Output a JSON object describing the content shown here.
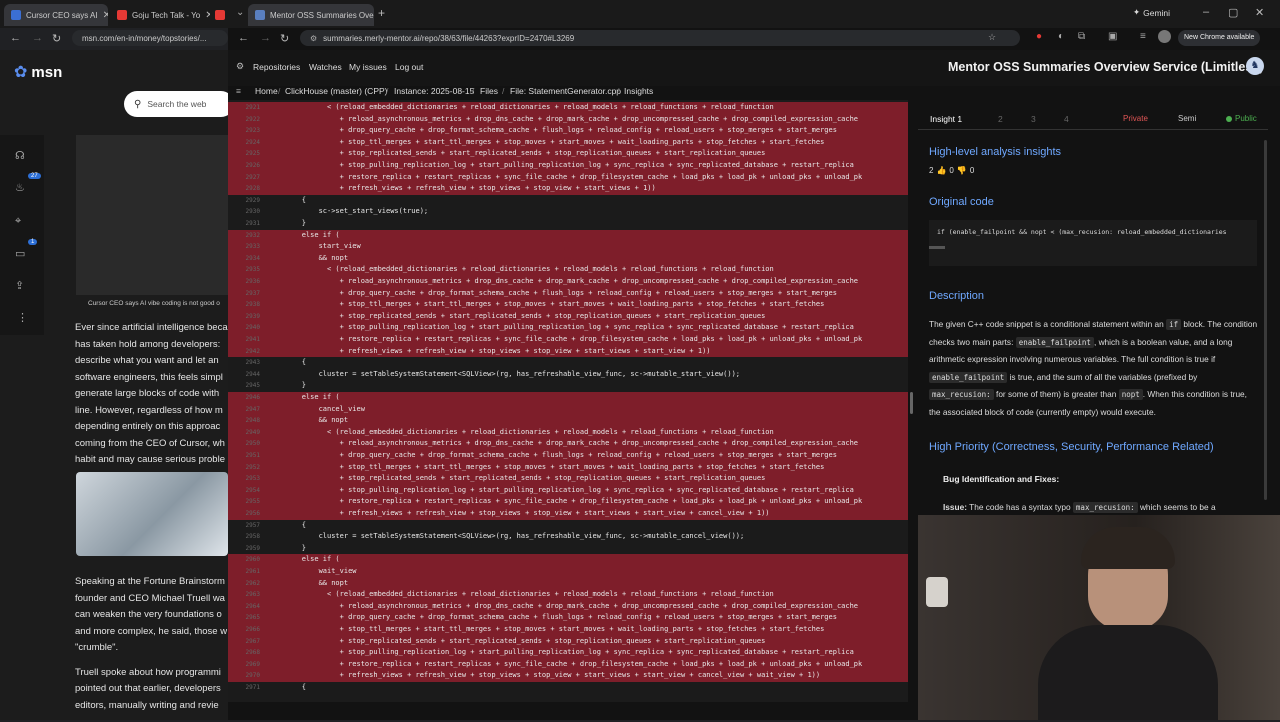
{
  "left_window": {
    "tabs": [
      {
        "title": "Cursor CEO says AI",
        "color": "#3b6fd4"
      },
      {
        "title": "Goju Tech Talk - Yo",
        "color": "#e53935"
      }
    ],
    "url": "msn.com/en-in/money/topstories/...",
    "brand": "msn",
    "search_placeholder": "Search the web",
    "badges": [
      "27",
      "1"
    ],
    "video_caption": "Cursor CEO says AI vibe coding is not good o",
    "paragraphs": [
      "Ever since artificial intelligence beca",
      "has taken hold among developers:",
      "describe what you want and let an",
      "software engineers, this feels simpl",
      "generate large blocks of code with",
      "line. However, regardless of how m",
      "depending entirely on this approac",
      "coming from the CEO of Cursor, wh",
      "habit and may cause serious proble"
    ],
    "paragraphs2": [
      "Speaking at the Fortune Brainstorm",
      "founder and CEO Michael Truell wa",
      "can weaken the very foundations o",
      "and more complex, he said, those w",
      "\"crumble\"."
    ],
    "paragraphs3": [
      "Truell spoke about how programmi",
      "pointed out that earlier, developers",
      "editors, manually writing and revie"
    ]
  },
  "right_window": {
    "tab_title": "Mentor OSS Summaries Overvi",
    "url": "summaries.merly-mentor.ai/repo/38/63/file/44263?exprID=2470#L3269",
    "gemini": "Gemini",
    "new_chrome": "New Chrome available",
    "nav": [
      "Repositories",
      "Watches",
      "My issues",
      "Log out"
    ],
    "site_title": "Mentor OSS Summaries Overview Service (Limitless)",
    "breadcrumb": [
      "Home",
      "ClickHouse (master) (CPP)",
      "Instance: 2025-08-15",
      "Files",
      "File: StatementGenerator.cpp",
      "Insights"
    ]
  },
  "code": {
    "lines": [
      {
        "n": "2921",
        "hl": true,
        "t": "              < (reload_embedded_dictionaries + reload_dictionaries + reload_models + reload_functions + reload_function"
      },
      {
        "n": "2922",
        "hl": true,
        "t": "                 + reload_asynchronous_metrics + drop_dns_cache + drop_mark_cache + drop_uncompressed_cache + drop_compiled_expression_cache"
      },
      {
        "n": "2923",
        "hl": true,
        "t": "                 + drop_query_cache + drop_format_schema_cache + flush_logs + reload_config + reload_users + stop_merges + start_merges"
      },
      {
        "n": "2924",
        "hl": true,
        "t": "                 + stop_ttl_merges + start_ttl_merges + stop_moves + start_moves + wait_loading_parts + stop_fetches + start_fetches"
      },
      {
        "n": "2925",
        "hl": true,
        "t": "                 + stop_replicated_sends + start_replicated_sends + stop_replication_queues + start_replication_queues"
      },
      {
        "n": "2926",
        "hl": true,
        "t": "                 + stop_pulling_replication_log + start_pulling_replication_log + sync_replica + sync_replicated_database + restart_replica"
      },
      {
        "n": "2927",
        "hl": true,
        "t": "                 + restore_replica + restart_replicas + sync_file_cache + drop_filesystem_cache + load_pks + load_pk + unload_pks + unload_pk"
      },
      {
        "n": "2928",
        "hl": true,
        "t": "                 + refresh_views + refresh_view + stop_views + stop_view + start_views + 1))"
      },
      {
        "n": "2929",
        "hl": false,
        "t": "        {"
      },
      {
        "n": "2930",
        "hl": false,
        "t": "            sc->set_start_views(true);"
      },
      {
        "n": "2931",
        "hl": false,
        "t": "        }"
      },
      {
        "n": "2932",
        "hl": true,
        "t": "        else if ("
      },
      {
        "n": "2933",
        "hl": true,
        "t": "            start_view"
      },
      {
        "n": "2934",
        "hl": true,
        "t": "            && nopt"
      },
      {
        "n": "2935",
        "hl": true,
        "t": "              < (reload_embedded_dictionaries + reload_dictionaries + reload_models + reload_functions + reload_function"
      },
      {
        "n": "2936",
        "hl": true,
        "t": "                 + reload_asynchronous_metrics + drop_dns_cache + drop_mark_cache + drop_uncompressed_cache + drop_compiled_expression_cache"
      },
      {
        "n": "2937",
        "hl": true,
        "t": "                 + drop_query_cache + drop_format_schema_cache + flush_logs + reload_config + reload_users + stop_merges + start_merges"
      },
      {
        "n": "2938",
        "hl": true,
        "t": "                 + stop_ttl_merges + start_ttl_merges + stop_moves + start_moves + wait_loading_parts + stop_fetches + start_fetches"
      },
      {
        "n": "2939",
        "hl": true,
        "t": "                 + stop_replicated_sends + start_replicated_sends + stop_replication_queues + start_replication_queues"
      },
      {
        "n": "2940",
        "hl": true,
        "t": "                 + stop_pulling_replication_log + start_pulling_replication_log + sync_replica + sync_replicated_database + restart_replica"
      },
      {
        "n": "2941",
        "hl": true,
        "t": "                 + restore_replica + restart_replicas + sync_file_cache + drop_filesystem_cache + load_pks + load_pk + unload_pks + unload_pk"
      },
      {
        "n": "2942",
        "hl": true,
        "t": "                 + refresh_views + refresh_view + stop_views + stop_view + start_views + start_view + 1))"
      },
      {
        "n": "2943",
        "hl": false,
        "t": "        {"
      },
      {
        "n": "2944",
        "hl": false,
        "t": "            cluster = setTableSystemStatement<SQLView>(rg, has_refreshable_view_func, sc->mutable_start_view());"
      },
      {
        "n": "2945",
        "hl": false,
        "t": "        }"
      },
      {
        "n": "2946",
        "hl": true,
        "t": "        else if ("
      },
      {
        "n": "2947",
        "hl": true,
        "t": "            cancel_view"
      },
      {
        "n": "2948",
        "hl": true,
        "t": "            && nopt"
      },
      {
        "n": "2949",
        "hl": true,
        "t": "              < (reload_embedded_dictionaries + reload_dictionaries + reload_models + reload_functions + reload_function"
      },
      {
        "n": "2950",
        "hl": true,
        "t": "                 + reload_asynchronous_metrics + drop_dns_cache + drop_mark_cache + drop_uncompressed_cache + drop_compiled_expression_cache"
      },
      {
        "n": "2951",
        "hl": true,
        "t": "                 + drop_query_cache + drop_format_schema_cache + flush_logs + reload_config + reload_users + stop_merges + start_merges"
      },
      {
        "n": "2952",
        "hl": true,
        "t": "                 + stop_ttl_merges + start_ttl_merges + stop_moves + start_moves + wait_loading_parts + stop_fetches + start_fetches"
      },
      {
        "n": "2953",
        "hl": true,
        "t": "                 + stop_replicated_sends + start_replicated_sends + stop_replication_queues + start_replication_queues"
      },
      {
        "n": "2954",
        "hl": true,
        "t": "                 + stop_pulling_replication_log + start_pulling_replication_log + sync_replica + sync_replicated_database + restart_replica"
      },
      {
        "n": "2955",
        "hl": true,
        "t": "                 + restore_replica + restart_replicas + sync_file_cache + drop_filesystem_cache + load_pks + load_pk + unload_pks + unload_pk"
      },
      {
        "n": "2956",
        "hl": true,
        "t": "                 + refresh_views + refresh_view + stop_views + stop_view + start_views + start_view + cancel_view + 1))"
      },
      {
        "n": "2957",
        "hl": false,
        "t": "        {"
      },
      {
        "n": "2958",
        "hl": false,
        "t": "            cluster = setTableSystemStatement<SQLView>(rg, has_refreshable_view_func, sc->mutable_cancel_view());"
      },
      {
        "n": "2959",
        "hl": false,
        "t": "        }"
      },
      {
        "n": "2960",
        "hl": true,
        "t": "        else if ("
      },
      {
        "n": "2961",
        "hl": true,
        "t": "            wait_view"
      },
      {
        "n": "2962",
        "hl": true,
        "t": "            && nopt"
      },
      {
        "n": "2963",
        "hl": true,
        "t": "              < (reload_embedded_dictionaries + reload_dictionaries + reload_models + reload_functions + reload_function"
      },
      {
        "n": "2964",
        "hl": true,
        "t": "                 + reload_asynchronous_metrics + drop_dns_cache + drop_mark_cache + drop_uncompressed_cache + drop_compiled_expression_cache"
      },
      {
        "n": "2965",
        "hl": true,
        "t": "                 + drop_query_cache + drop_format_schema_cache + flush_logs + reload_config + reload_users + stop_merges + start_merges"
      },
      {
        "n": "2966",
        "hl": true,
        "t": "                 + stop_ttl_merges + start_ttl_merges + stop_moves + start_moves + wait_loading_parts + stop_fetches + start_fetches"
      },
      {
        "n": "2967",
        "hl": true,
        "t": "                 + stop_replicated_sends + start_replicated_sends + stop_replication_queues + start_replication_queues"
      },
      {
        "n": "2968",
        "hl": true,
        "t": "                 + stop_pulling_replication_log + start_pulling_replication_log + sync_replica + sync_replicated_database + restart_replica"
      },
      {
        "n": "2969",
        "hl": true,
        "t": "                 + restore_replica + restart_replicas + sync_file_cache + drop_filesystem_cache + load_pks + load_pk + unload_pks + unload_pk"
      },
      {
        "n": "2970",
        "hl": true,
        "t": "                 + refresh_views + refresh_view + stop_views + stop_view + start_views + start_view + cancel_view + wait_view + 1))"
      },
      {
        "n": "2971",
        "hl": false,
        "t": "        {"
      }
    ]
  },
  "insights": {
    "tabs": [
      "Insight 1",
      "2",
      "3",
      "4"
    ],
    "visibility": [
      "Private",
      "Semi",
      "Public"
    ],
    "heading1": "High-level analysis insights",
    "votes": {
      "count": "2",
      "up": "0",
      "down": "0"
    },
    "original_code_title": "Original code",
    "original_code": "if (enable_failpoint && nopt < (max_recusion: reload_embedded_dictionaries",
    "description_title": "Description",
    "desc": {
      "a": "The given C++ code snippet is a conditional statement within an",
      "a_code": "if",
      "b": "block. The condition checks two main parts:",
      "b_code": "enable_failpoint",
      "c": ", which is a boolean value, and a long arithmetic expression involving numerous variables. The full condition is true if",
      "c_code": "enable_failpoint",
      "d": "is true, and the sum of all the variables (prefixed by",
      "d_code": "max_recusion:",
      "e": "for some of them) is greater than",
      "e_code": "nopt",
      "f": ". When this condition is true, the associated block of code (currently empty) would execute."
    },
    "priority_title": "High Priority (Correctness, Security, Performance Related)",
    "bug_title": "Bug Identification and Fixes:",
    "issue_label": "Issue:",
    "issue_text": "The code has a syntax typo",
    "issue_code": "max_recusion:",
    "issue_tail": "which seems to be a"
  },
  "colors": {
    "highlight": "#7e1e2a",
    "accent": "#6fa8ff",
    "private": "#e05555",
    "public": "#4caf50"
  }
}
